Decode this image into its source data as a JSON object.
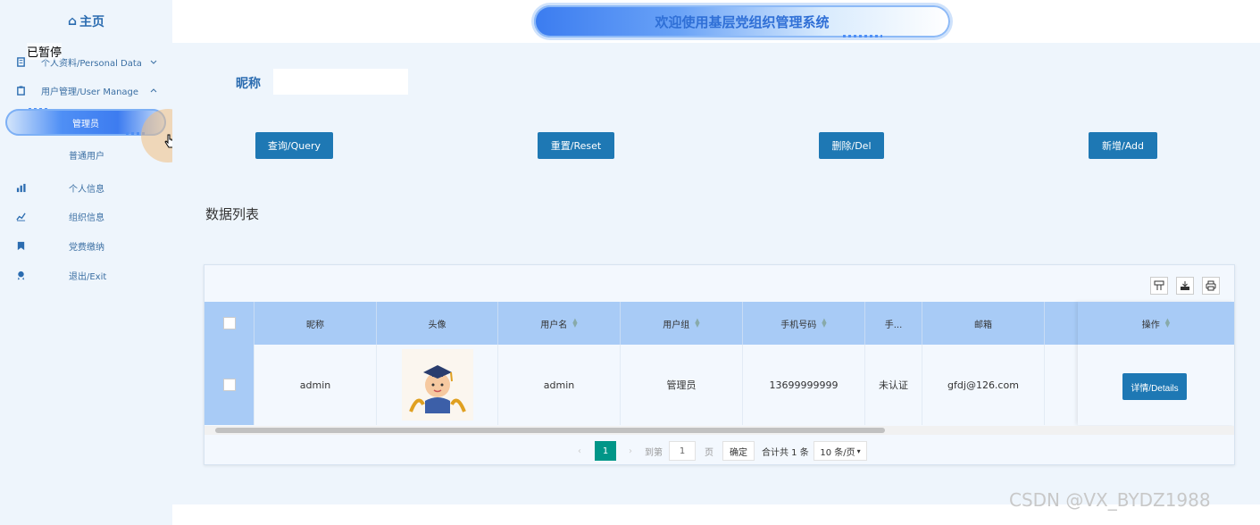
{
  "sidebar": {
    "home": "主页",
    "paused": "已暂停",
    "items": [
      {
        "label": "个人资料/Personal Data",
        "icon": "document-icon"
      },
      {
        "label": "用户管理/User Manage",
        "icon": "clipboard-icon"
      },
      {
        "label": "管理员",
        "active": true
      },
      {
        "label": "普通用户"
      },
      {
        "label": "个人信息",
        "icon": "bar-chart-icon"
      },
      {
        "label": "组织信息",
        "icon": "area-chart-icon"
      },
      {
        "label": "党费缴纳",
        "icon": "bookmark-icon"
      },
      {
        "label": "退出/Exit",
        "icon": "user-badge-icon"
      }
    ]
  },
  "header": {
    "title": "欢迎使用基层党组织管理系统"
  },
  "search": {
    "label": "昵称",
    "value": ""
  },
  "buttons": {
    "query": "查询/Query",
    "reset": "重置/Reset",
    "delete": "删除/Del",
    "add": "新增/Add"
  },
  "list": {
    "title": "数据列表"
  },
  "table": {
    "columns": [
      "昵称",
      "头像",
      "用户名",
      "用户组",
      "手机号码",
      "手...",
      "邮箱",
      "操作"
    ],
    "rows": [
      {
        "nickname": "admin",
        "username": "admin",
        "group": "管理员",
        "phone": "13699999999",
        "status": "未认证",
        "email": "gfdj@126.com",
        "action": "详情/Details"
      }
    ]
  },
  "pager": {
    "current": "1",
    "goto_label": "到第",
    "goto_value": "1",
    "page_unit": "页",
    "confirm": "确定",
    "total": "合计共 1 条",
    "page_size": "10 条/页"
  },
  "watermark": "CSDN @VX_BYDZ1988",
  "colors": {
    "accent": "#1e78b4",
    "header_row": "#a8cbf6",
    "background": "#eef5fc",
    "pager_active": "#009688"
  }
}
